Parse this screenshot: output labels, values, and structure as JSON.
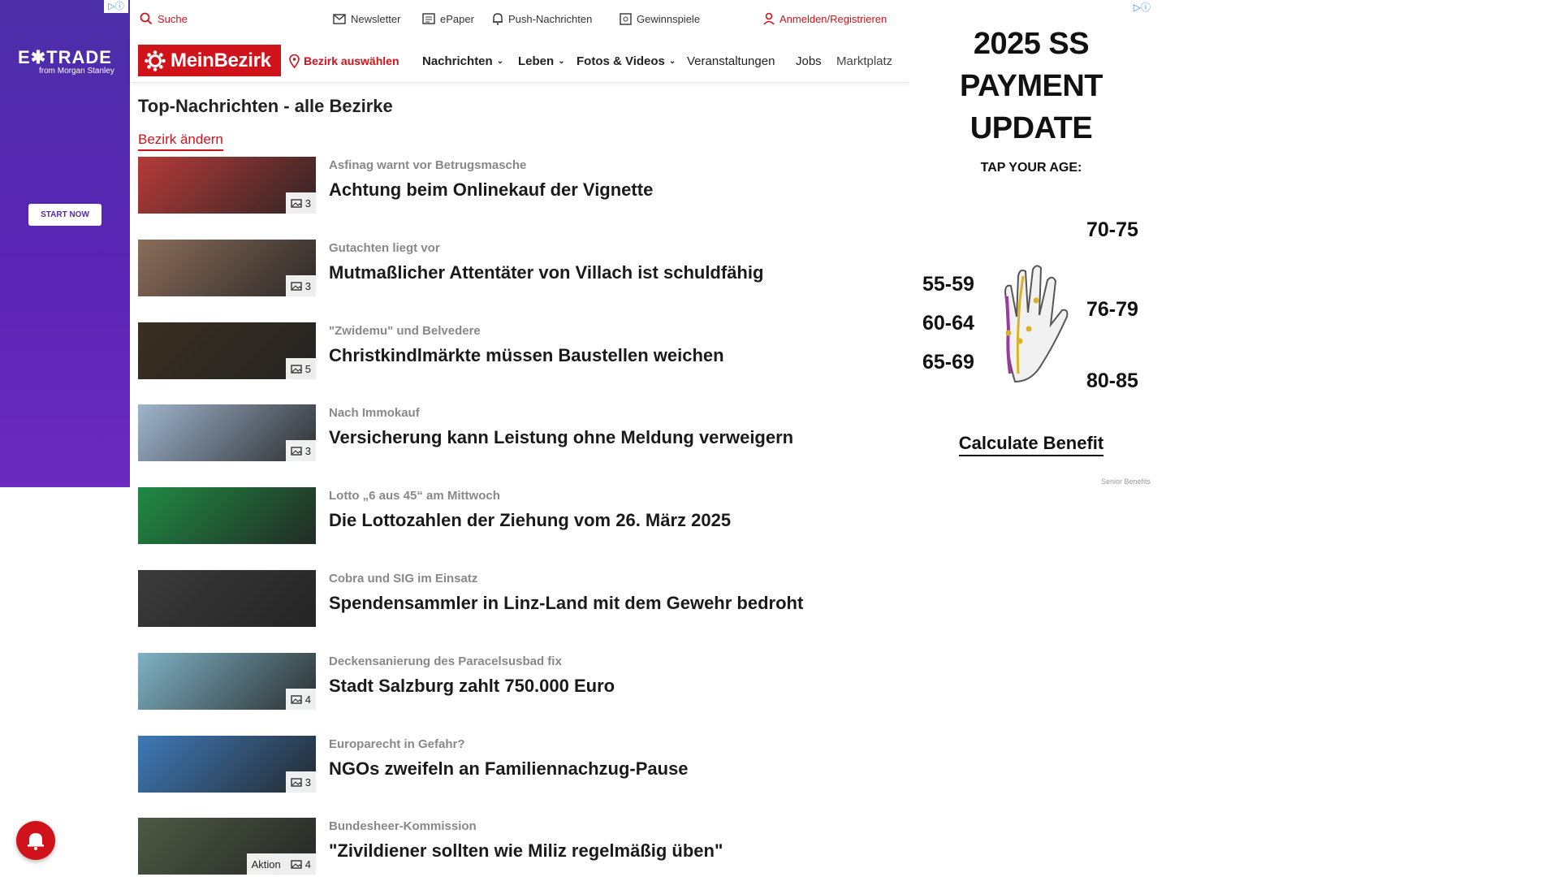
{
  "left_ad": {
    "adchoices": "▷ⓘ",
    "brand": "E✱TRADE",
    "sub": "from Morgan Stanley",
    "cta": "START NOW"
  },
  "topbar": {
    "search": "Suche",
    "newsletter": "Newsletter",
    "epaper": "ePaper",
    "push": "Push-Nachrichten",
    "gewinnspiele": "Gewinnspiele",
    "login": "Anmelden/Registrieren"
  },
  "nav": {
    "logo": "MeinBezirk",
    "bezirk": "Bezirk auswählen",
    "items": [
      "Nachrichten",
      "Leben",
      "Fotos & Videos",
      "Veranstaltungen",
      "Jobs",
      "Marktplatz"
    ]
  },
  "page": {
    "title": "Top-Nachrichten - alle Bezirke",
    "change_link": "Bezirk ändern"
  },
  "articles": [
    {
      "kicker": "Asfinag warnt vor Betrugsmasche",
      "headline": "Achtung beim Onlinekauf der Vignette",
      "count": "3",
      "tone": "#b73a3a"
    },
    {
      "kicker": "Gutachten liegt vor",
      "headline": "Mutmaßlicher Attentäter von Villach ist schuldfähig",
      "count": "3",
      "tone": "#8a6d5a"
    },
    {
      "kicker": "\"Zwidemu\" und Belvedere",
      "headline": "Christkindlmärkte müssen Baustellen weichen",
      "count": "5",
      "tone": "#3a2f22"
    },
    {
      "kicker": "Nach Immokauf",
      "headline": "Versicherung kann Leistung ohne Meldung verweigern",
      "count": "3",
      "tone": "#9fb5cc"
    },
    {
      "kicker": "Lotto „6 aus 45“ am Mittwoch",
      "headline": "Die Lottozahlen der Ziehung vom 26. März 2025",
      "count": "",
      "tone": "#1f8a43"
    },
    {
      "kicker": "Cobra und SIG im Einsatz",
      "headline": "Spendensammler in Linz-Land mit dem Gewehr bedroht",
      "count": "",
      "tone": "#3b3b3b"
    },
    {
      "kicker": "Deckensanierung des Paracelsusbad fix",
      "headline": "Stadt Salzburg zahlt 750.000 Euro",
      "count": "4",
      "tone": "#7fb2c4"
    },
    {
      "kicker": "Europarecht in Gefahr?",
      "headline": "NGOs zweifeln an Familiennachzug-Pause",
      "count": "3",
      "tone": "#3e79b8"
    },
    {
      "kicker": "Bundesheer-Kommission",
      "headline": "\"Zivildiener sollten wie Miliz regelmäßig üben\"",
      "count": "4",
      "tone": "#4d5a44",
      "aktion": "Aktion"
    }
  ],
  "right_ad": {
    "adchoices": "▷ⓘ",
    "headline_line1": "2025 SS PAYMENT",
    "headline_line2": "UPDATE",
    "tap": "TAP YOUR AGE:",
    "ages": [
      "55-59",
      "60-64",
      "65-69",
      "70-75",
      "76-79",
      "80-85"
    ],
    "cta": "Calculate Benefit",
    "sponsor": "Senior Benefits"
  },
  "colors": {
    "brand_red": "#d0121b",
    "text": "#1a1a1a",
    "kicker": "#888888"
  }
}
